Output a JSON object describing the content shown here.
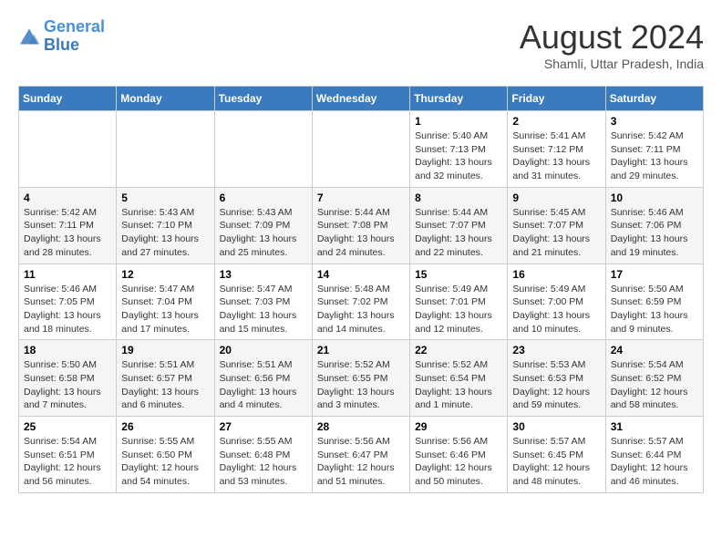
{
  "header": {
    "logo_line1": "General",
    "logo_line2": "Blue",
    "month_title": "August 2024",
    "location": "Shamli, Uttar Pradesh, India"
  },
  "weekdays": [
    "Sunday",
    "Monday",
    "Tuesday",
    "Wednesday",
    "Thursday",
    "Friday",
    "Saturday"
  ],
  "weeks": [
    [
      {
        "day": "",
        "info": ""
      },
      {
        "day": "",
        "info": ""
      },
      {
        "day": "",
        "info": ""
      },
      {
        "day": "",
        "info": ""
      },
      {
        "day": "1",
        "info": "Sunrise: 5:40 AM\nSunset: 7:13 PM\nDaylight: 13 hours\nand 32 minutes."
      },
      {
        "day": "2",
        "info": "Sunrise: 5:41 AM\nSunset: 7:12 PM\nDaylight: 13 hours\nand 31 minutes."
      },
      {
        "day": "3",
        "info": "Sunrise: 5:42 AM\nSunset: 7:11 PM\nDaylight: 13 hours\nand 29 minutes."
      }
    ],
    [
      {
        "day": "4",
        "info": "Sunrise: 5:42 AM\nSunset: 7:11 PM\nDaylight: 13 hours\nand 28 minutes."
      },
      {
        "day": "5",
        "info": "Sunrise: 5:43 AM\nSunset: 7:10 PM\nDaylight: 13 hours\nand 27 minutes."
      },
      {
        "day": "6",
        "info": "Sunrise: 5:43 AM\nSunset: 7:09 PM\nDaylight: 13 hours\nand 25 minutes."
      },
      {
        "day": "7",
        "info": "Sunrise: 5:44 AM\nSunset: 7:08 PM\nDaylight: 13 hours\nand 24 minutes."
      },
      {
        "day": "8",
        "info": "Sunrise: 5:44 AM\nSunset: 7:07 PM\nDaylight: 13 hours\nand 22 minutes."
      },
      {
        "day": "9",
        "info": "Sunrise: 5:45 AM\nSunset: 7:07 PM\nDaylight: 13 hours\nand 21 minutes."
      },
      {
        "day": "10",
        "info": "Sunrise: 5:46 AM\nSunset: 7:06 PM\nDaylight: 13 hours\nand 19 minutes."
      }
    ],
    [
      {
        "day": "11",
        "info": "Sunrise: 5:46 AM\nSunset: 7:05 PM\nDaylight: 13 hours\nand 18 minutes."
      },
      {
        "day": "12",
        "info": "Sunrise: 5:47 AM\nSunset: 7:04 PM\nDaylight: 13 hours\nand 17 minutes."
      },
      {
        "day": "13",
        "info": "Sunrise: 5:47 AM\nSunset: 7:03 PM\nDaylight: 13 hours\nand 15 minutes."
      },
      {
        "day": "14",
        "info": "Sunrise: 5:48 AM\nSunset: 7:02 PM\nDaylight: 13 hours\nand 14 minutes."
      },
      {
        "day": "15",
        "info": "Sunrise: 5:49 AM\nSunset: 7:01 PM\nDaylight: 13 hours\nand 12 minutes."
      },
      {
        "day": "16",
        "info": "Sunrise: 5:49 AM\nSunset: 7:00 PM\nDaylight: 13 hours\nand 10 minutes."
      },
      {
        "day": "17",
        "info": "Sunrise: 5:50 AM\nSunset: 6:59 PM\nDaylight: 13 hours\nand 9 minutes."
      }
    ],
    [
      {
        "day": "18",
        "info": "Sunrise: 5:50 AM\nSunset: 6:58 PM\nDaylight: 13 hours\nand 7 minutes."
      },
      {
        "day": "19",
        "info": "Sunrise: 5:51 AM\nSunset: 6:57 PM\nDaylight: 13 hours\nand 6 minutes."
      },
      {
        "day": "20",
        "info": "Sunrise: 5:51 AM\nSunset: 6:56 PM\nDaylight: 13 hours\nand 4 minutes."
      },
      {
        "day": "21",
        "info": "Sunrise: 5:52 AM\nSunset: 6:55 PM\nDaylight: 13 hours\nand 3 minutes."
      },
      {
        "day": "22",
        "info": "Sunrise: 5:52 AM\nSunset: 6:54 PM\nDaylight: 13 hours\nand 1 minute."
      },
      {
        "day": "23",
        "info": "Sunrise: 5:53 AM\nSunset: 6:53 PM\nDaylight: 12 hours\nand 59 minutes."
      },
      {
        "day": "24",
        "info": "Sunrise: 5:54 AM\nSunset: 6:52 PM\nDaylight: 12 hours\nand 58 minutes."
      }
    ],
    [
      {
        "day": "25",
        "info": "Sunrise: 5:54 AM\nSunset: 6:51 PM\nDaylight: 12 hours\nand 56 minutes."
      },
      {
        "day": "26",
        "info": "Sunrise: 5:55 AM\nSunset: 6:50 PM\nDaylight: 12 hours\nand 54 minutes."
      },
      {
        "day": "27",
        "info": "Sunrise: 5:55 AM\nSunset: 6:48 PM\nDaylight: 12 hours\nand 53 minutes."
      },
      {
        "day": "28",
        "info": "Sunrise: 5:56 AM\nSunset: 6:47 PM\nDaylight: 12 hours\nand 51 minutes."
      },
      {
        "day": "29",
        "info": "Sunrise: 5:56 AM\nSunset: 6:46 PM\nDaylight: 12 hours\nand 50 minutes."
      },
      {
        "day": "30",
        "info": "Sunrise: 5:57 AM\nSunset: 6:45 PM\nDaylight: 12 hours\nand 48 minutes."
      },
      {
        "day": "31",
        "info": "Sunrise: 5:57 AM\nSunset: 6:44 PM\nDaylight: 12 hours\nand 46 minutes."
      }
    ]
  ]
}
